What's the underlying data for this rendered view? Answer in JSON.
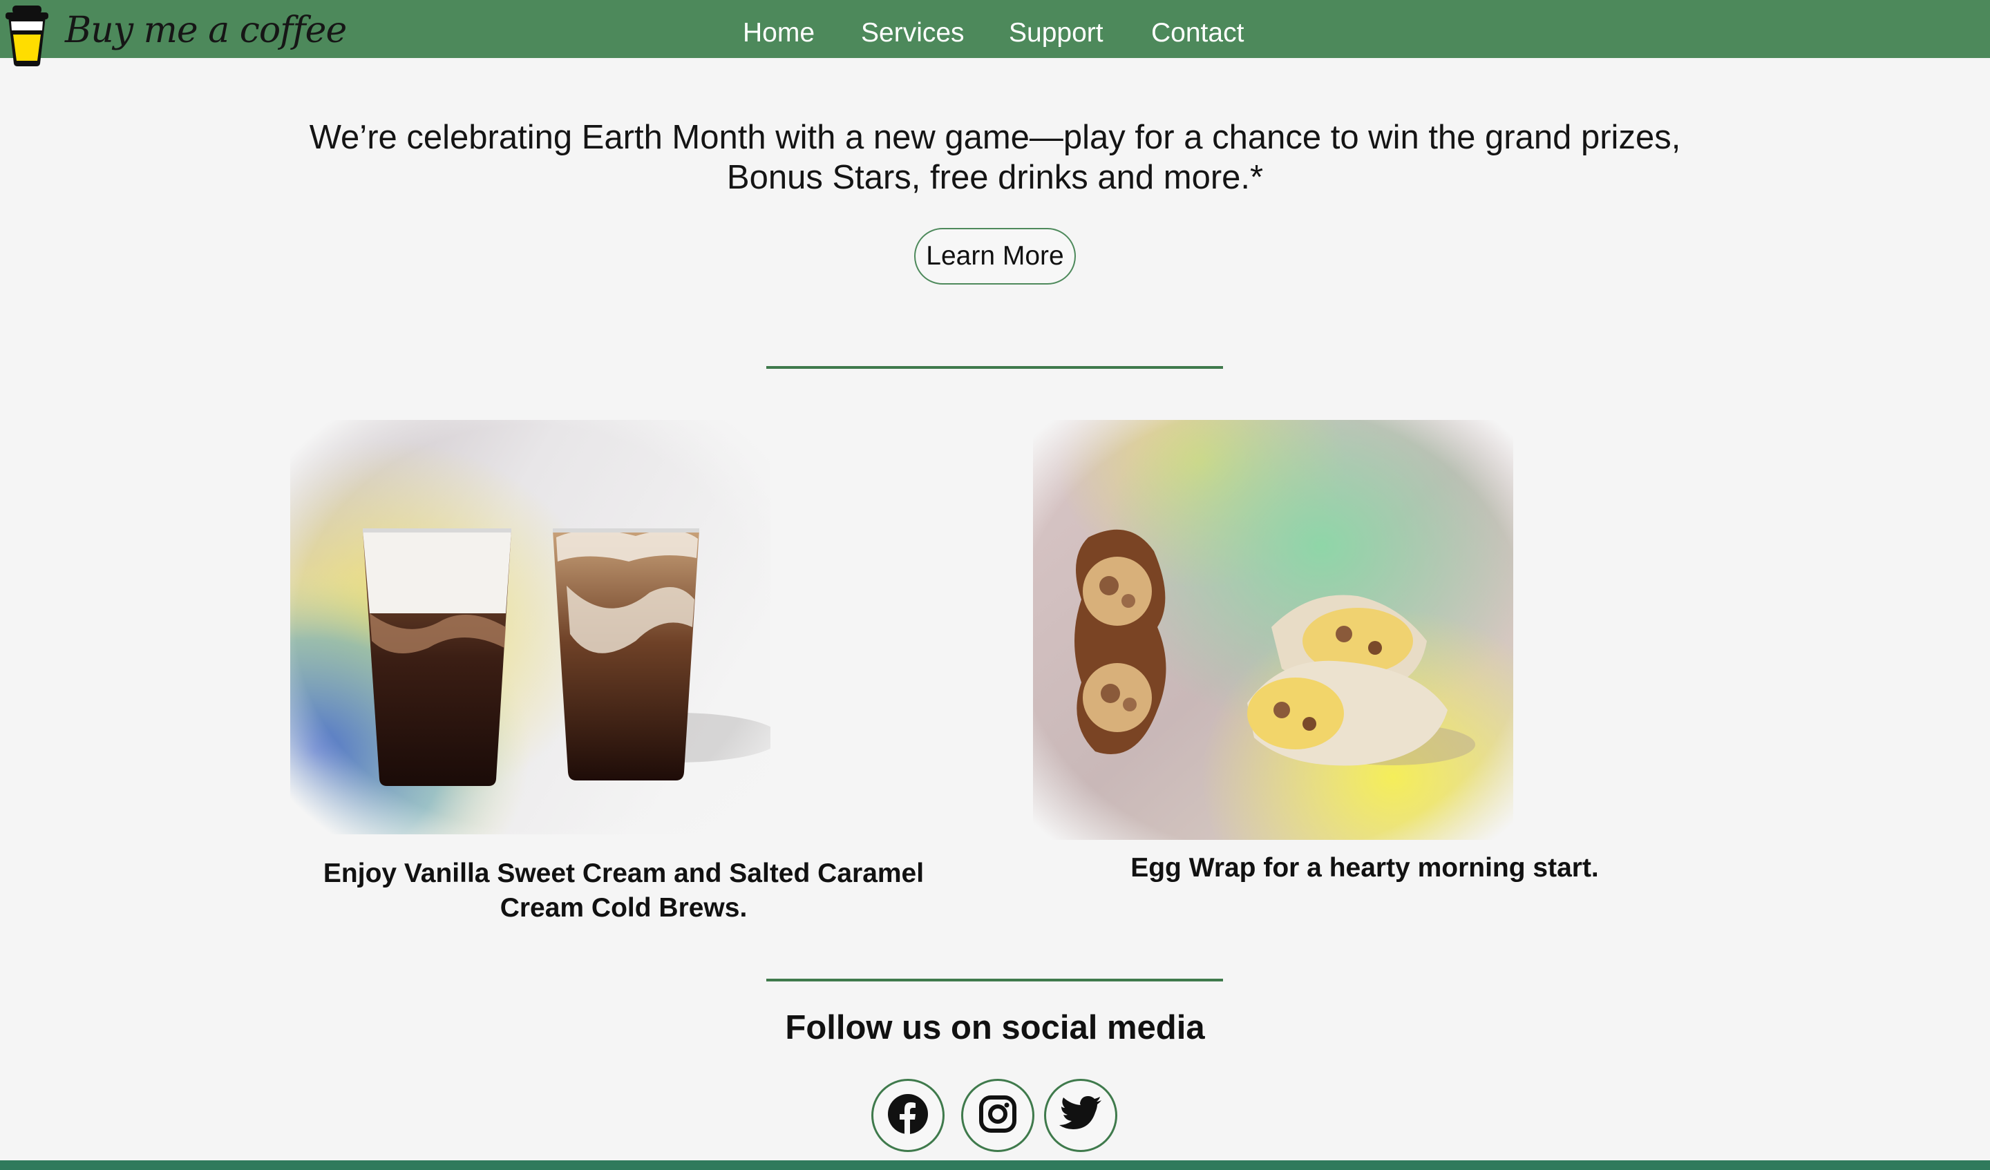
{
  "header": {
    "brand": "Buy me a coffee",
    "nav": [
      "Home",
      "Services",
      "Support",
      "Contact"
    ]
  },
  "hero": {
    "line1": "We’re celebrating Earth Month with a new game—play for a chance to win the grand prizes,",
    "line2": "Bonus Stars, free drinks and more.*",
    "button": "Learn More"
  },
  "products": [
    {
      "caption_line1": "Enjoy Vanilla Sweet Cream and Salted Caramel",
      "caption_line2": "Cream Cold Brews."
    },
    {
      "caption": "Egg Wrap for a hearty morning start."
    }
  ],
  "social": {
    "title": "Follow us on social media",
    "icons": [
      "facebook-icon",
      "instagram-icon",
      "twitter-icon"
    ]
  },
  "colors": {
    "header_bg": "#4d895b",
    "accent_green": "#3f7a4c",
    "page_bg": "#f5f5f5",
    "footer_bar": "#2f7a5c"
  }
}
